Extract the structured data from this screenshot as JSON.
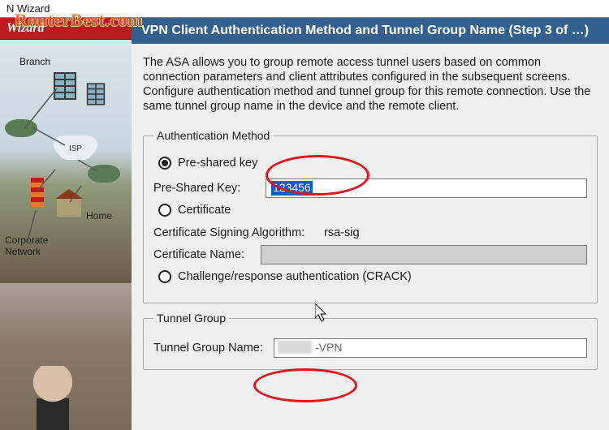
{
  "watermark": "RouterBest.com",
  "window": {
    "title": "N Wizard"
  },
  "wizard": {
    "header": "Wizard",
    "diagram": {
      "branch": "Branch",
      "isp": "ISP",
      "home": "Home",
      "corporate": "Corporate\nNetwork"
    }
  },
  "step": {
    "banner": "VPN Client Authentication Method and Tunnel Group Name  (Step 3 of …)",
    "instructions": "The ASA allows you to group remote access tunnel users based on common connection parameters and client attributes configured in the subsequent screens. Configure authentication method and tunnel group for this remote connection. Use the same tunnel group name in the device and the remote client."
  },
  "auth": {
    "legend": "Authentication Method",
    "psk_option": "Pre-shared key",
    "psk_label": "Pre-Shared Key:",
    "psk_value": "123456",
    "cert_option": "Certificate",
    "cert_alg_label": "Certificate Signing Algorithm:",
    "cert_alg_value": "rsa-sig",
    "cert_name_label": "Certificate Name:",
    "cert_name_value": "",
    "crack_option": "Challenge/response authentication (CRACK)"
  },
  "tunnel": {
    "legend": "Tunnel Group",
    "name_label": "Tunnel Group Name:",
    "name_value_suffix": "-VPN"
  }
}
